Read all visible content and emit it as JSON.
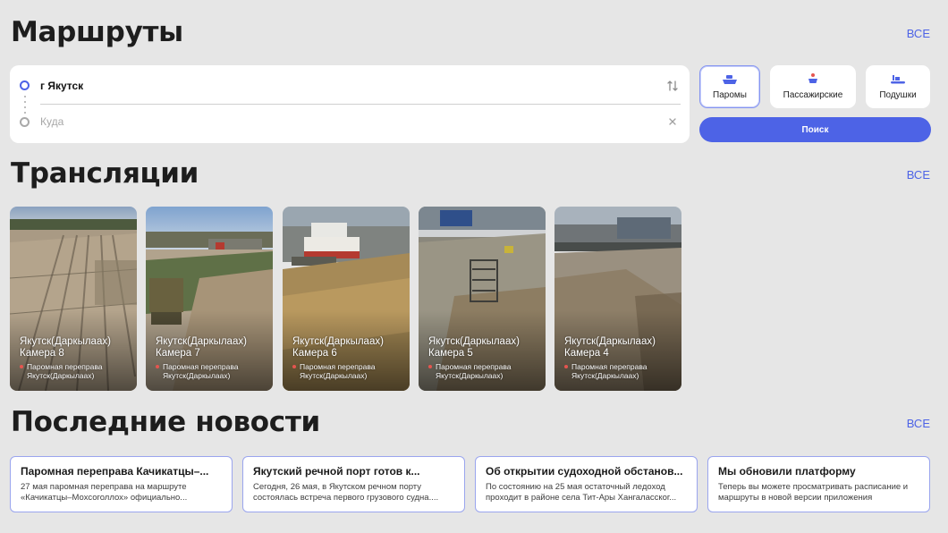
{
  "routes": {
    "title": "Маршруты",
    "all_label": "ВСЕ",
    "from_value": "г Якутск",
    "to_placeholder": "Куда",
    "swap_icon": "swap-vertical-icon",
    "clear_icon": "close-icon",
    "transport_types": [
      {
        "label": "Паромы",
        "icon": "ferry-icon",
        "active": true
      },
      {
        "label": "Пассажирские",
        "icon": "passenger-boat-icon",
        "active": false
      },
      {
        "label": "Подушки",
        "icon": "hovercraft-icon",
        "active": false
      }
    ],
    "search_label": "Поиск",
    "accent_color": "#4d63e6"
  },
  "streams": {
    "title": "Трансляции",
    "all_label": "ВСЕ",
    "items": [
      {
        "place": "Якутск(Даркылаах)",
        "camera": "Камера 8",
        "route_line1": "Паромная переправа",
        "route_line2": "Якутск(Даркылаах)"
      },
      {
        "place": "Якутск(Даркылаах)",
        "camera": "Камера 7",
        "route_line1": "Паромная переправа",
        "route_line2": "Якутск(Даркылаах)"
      },
      {
        "place": "Якутск(Даркылаах)",
        "camera": "Камера 6",
        "route_line1": "Паромная переправа",
        "route_line2": "Якутск(Даркылаах)"
      },
      {
        "place": "Якутск(Даркылаах)",
        "camera": "Камера 5",
        "route_line1": "Паромная переправа",
        "route_line2": "Якутск(Даркылаах)"
      },
      {
        "place": "Якутск(Даркылаах)",
        "camera": "Камера 4",
        "route_line1": "Паромная переправа",
        "route_line2": "Якутск(Даркылаах)"
      }
    ]
  },
  "news": {
    "title": "Последние новости",
    "all_label": "ВСЕ",
    "items": [
      {
        "title": "Паромная переправа Качикатцы–...",
        "line1": "27 мая паромная переправа на маршруте",
        "line2": "«Качикатцы–Мохсоголлох» официально..."
      },
      {
        "title": "Якутский речной порт готов к...",
        "line1": "Сегодня, 26 мая, в Якутском речном порту",
        "line2": "состоялась встреча первого грузового судна...."
      },
      {
        "title": "Об открытии судоходной обстанов...",
        "line1": "По состоянию на 25 мая остаточный ледоход",
        "line2": "проходит в районе села Тит-Ары Хангаласског..."
      },
      {
        "title": "Мы обновили платформу",
        "line1": "Теперь вы можете просматривать расписание и",
        "line2": "маршруты в новой версии приложения"
      }
    ]
  }
}
